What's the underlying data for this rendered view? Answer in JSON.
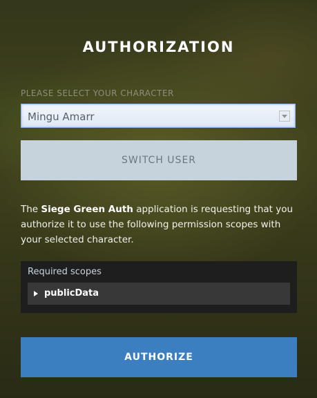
{
  "page": {
    "title": "AUTHORIZATION"
  },
  "character_select": {
    "label": "PLEASE SELECT YOUR CHARACTER",
    "selected": "Mingu Amarr"
  },
  "switch_user": {
    "label": "SWITCH USER"
  },
  "description": {
    "prefix": "The ",
    "app_name": "Siege Green Auth",
    "suffix": " application is requesting that you authorize it to use the following permission scopes with your selected character."
  },
  "scopes": {
    "title": "Required scopes",
    "items": [
      {
        "label": "publicData",
        "icon": "expand-triangle-icon"
      }
    ]
  },
  "authorize": {
    "label": "AUTHORIZE"
  },
  "colors": {
    "authorize_button": "#3b7fc0",
    "switch_button": "#c7d3dc",
    "scopes_panel": "#1e1e1e"
  }
}
